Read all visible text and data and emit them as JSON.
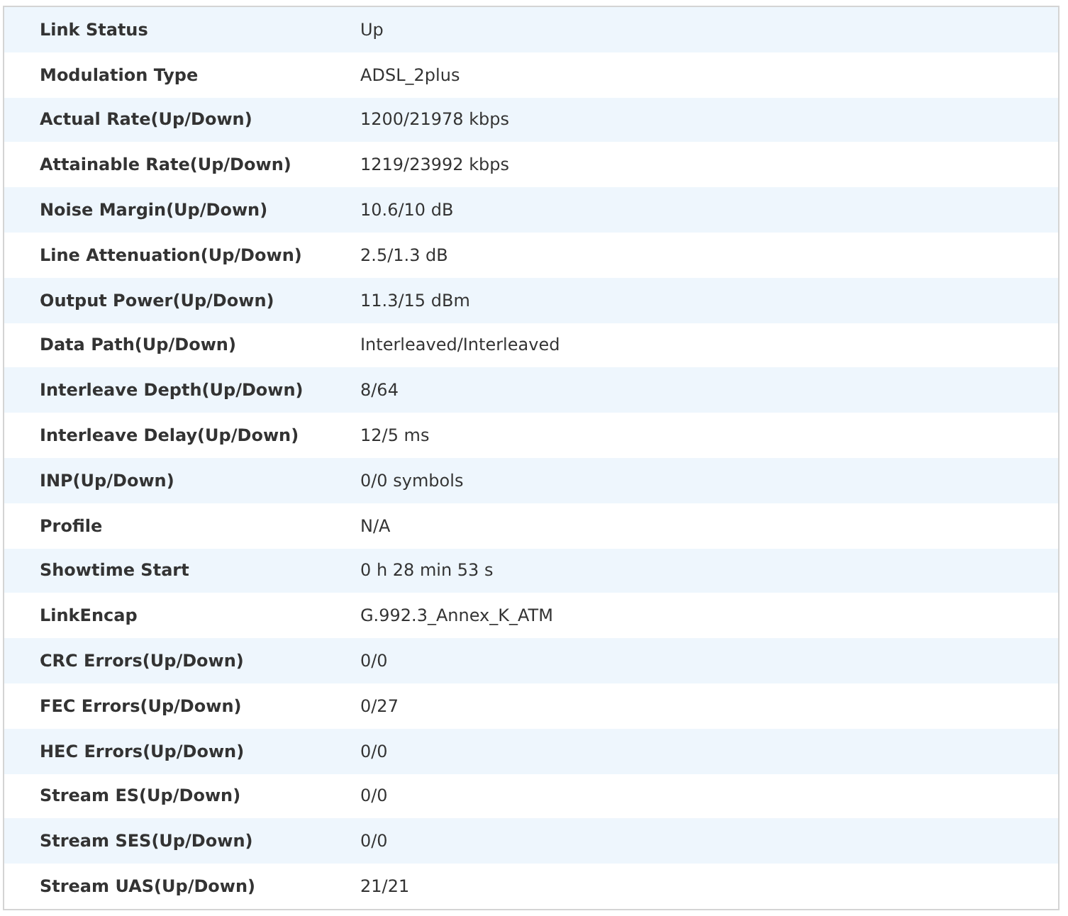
{
  "rows": [
    {
      "label": "Link Status",
      "value": "Up"
    },
    {
      "label": "Modulation Type",
      "value": "ADSL_2plus"
    },
    {
      "label": "Actual Rate(Up/Down)",
      "value": "1200/21978 kbps"
    },
    {
      "label": "Attainable Rate(Up/Down)",
      "value": "1219/23992 kbps"
    },
    {
      "label": "Noise Margin(Up/Down)",
      "value": "10.6/10 dB"
    },
    {
      "label": "Line Attenuation(Up/Down)",
      "value": "2.5/1.3 dB"
    },
    {
      "label": "Output Power(Up/Down)",
      "value": "11.3/15 dBm"
    },
    {
      "label": "Data Path(Up/Down)",
      "value": "Interleaved/Interleaved"
    },
    {
      "label": "Interleave Depth(Up/Down)",
      "value": "8/64"
    },
    {
      "label": "Interleave Delay(Up/Down)",
      "value": "12/5 ms"
    },
    {
      "label": "INP(Up/Down)",
      "value": "0/0 symbols"
    },
    {
      "label": "Profile",
      "value": "N/A"
    },
    {
      "label": "Showtime Start",
      "value": "0 h 28 min 53 s"
    },
    {
      "label": "LinkEncap",
      "value": "G.992.3_Annex_K_ATM"
    },
    {
      "label": "CRC Errors(Up/Down)",
      "value": "0/0"
    },
    {
      "label": "FEC Errors(Up/Down)",
      "value": "0/27"
    },
    {
      "label": "HEC Errors(Up/Down)",
      "value": "0/0"
    },
    {
      "label": "Stream ES(Up/Down)",
      "value": "0/0"
    },
    {
      "label": "Stream SES(Up/Down)",
      "value": "0/0"
    },
    {
      "label": "Stream UAS(Up/Down)",
      "value": "21/21"
    }
  ]
}
